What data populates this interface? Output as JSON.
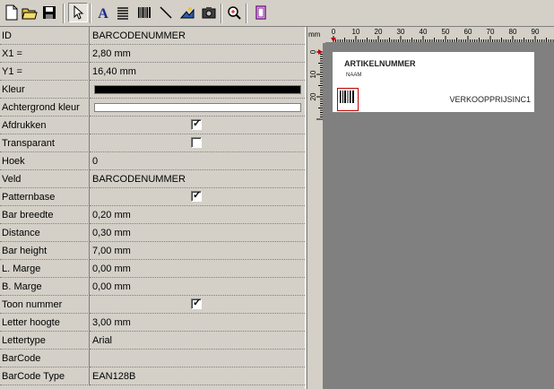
{
  "toolbar": {
    "buttons": [
      {
        "name": "new-document-icon"
      },
      {
        "name": "open-folder-icon"
      },
      {
        "name": "save-disk-icon"
      },
      {
        "name": "pointer-select-icon",
        "pressed": true
      },
      {
        "name": "text-tool-icon"
      },
      {
        "name": "lines-text-icon"
      },
      {
        "name": "barcode-tool-icon"
      },
      {
        "name": "line-tool-icon"
      },
      {
        "name": "image-tool-icon"
      },
      {
        "name": "camera-icon"
      },
      {
        "name": "zoom-icon"
      },
      {
        "name": "page-layout-icon"
      }
    ]
  },
  "properties": [
    {
      "label": "ID",
      "value": "BARCODENUMMER",
      "type": "text"
    },
    {
      "label": "X1 =",
      "value": "2,80 mm",
      "type": "text"
    },
    {
      "label": "Y1 =",
      "value": "16,40 mm",
      "type": "text"
    },
    {
      "label": "Kleur",
      "value": "",
      "type": "color",
      "color": "#000000"
    },
    {
      "label": "Achtergrond kleur",
      "value": "",
      "type": "color",
      "color": "#ffffff"
    },
    {
      "label": "Afdrukken",
      "value": "",
      "type": "check",
      "checked": true
    },
    {
      "label": "Transparant",
      "value": "",
      "type": "check",
      "checked": false
    },
    {
      "label": "Hoek",
      "value": "0",
      "type": "text"
    },
    {
      "label": "Veld",
      "value": "BARCODENUMMER",
      "type": "text"
    },
    {
      "label": "Patternbase",
      "value": "",
      "type": "check",
      "checked": true
    },
    {
      "label": "Bar breedte",
      "value": "0,20 mm",
      "type": "text"
    },
    {
      "label": "Distance",
      "value": "0,30 mm",
      "type": "text"
    },
    {
      "label": "Bar height",
      "value": "7,00 mm",
      "type": "text"
    },
    {
      "label": "L. Marge",
      "value": "0,00 mm",
      "type": "text"
    },
    {
      "label": "B. Marge",
      "value": "0,00 mm",
      "type": "text"
    },
    {
      "label": "Toon nummer",
      "value": "",
      "type": "check",
      "checked": true
    },
    {
      "label": "Letter hoogte",
      "value": "3,00 mm",
      "type": "text"
    },
    {
      "label": "Lettertype",
      "value": "Arial",
      "type": "text"
    },
    {
      "label": "BarCode",
      "value": "",
      "type": "text"
    },
    {
      "label": "BarCode Type",
      "value": "EAN128B",
      "type": "text"
    }
  ],
  "designer": {
    "ruler_unit": "mm",
    "ruler_h_ticks": [
      "0",
      "10",
      "20",
      "30",
      "40",
      "50",
      "60",
      "70",
      "80",
      "90"
    ],
    "ruler_v_ticks": [
      "0",
      "10",
      "20"
    ],
    "label": {
      "artikelnummer": "ARTIKELNUMMER",
      "naam": "NAAM",
      "verkoopprijs": "VERKOOPPRIJSINC1"
    }
  },
  "colors": {
    "chrome": "#d4d0c8",
    "canvas": "#808080",
    "selection": "#c00000"
  }
}
